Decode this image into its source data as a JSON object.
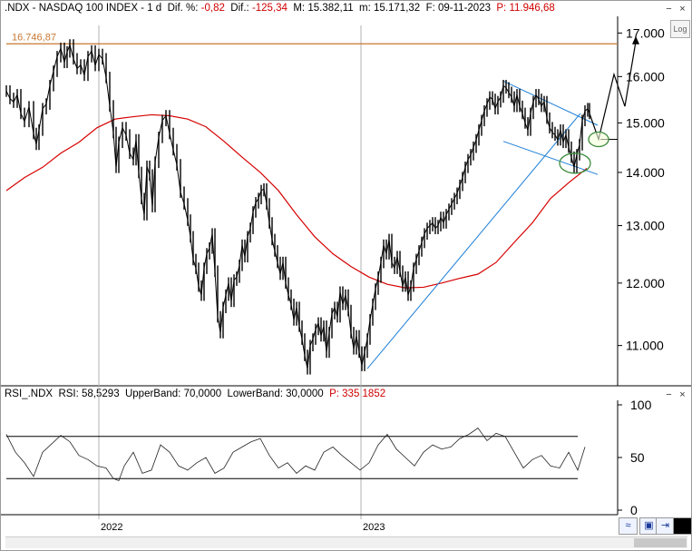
{
  "header": {
    "symbol": ".NDX - NASDAQ 100 INDEX - 1 d",
    "dif_pct_label": "Dif. %:",
    "dif_pct_value": "-0,82",
    "dif_label": "Dif.:",
    "dif_value": "-125,34",
    "max_label": "M:",
    "max_value": "15.382,11",
    "min_label": "m:",
    "min_value": "15.171,32",
    "date_label": "F:",
    "date_value": "09-11-2023",
    "p_label": "P:",
    "p_value": "11.946,68"
  },
  "sub_header": {
    "name": "RSI_.NDX",
    "rsi_label": "RSI:",
    "rsi_value": "58,5293",
    "upper_label": "UpperBand:",
    "upper_value": "70,0000",
    "lower_label": "LowerBand:",
    "lower_value": "30,0000",
    "p_label": "P:",
    "p_value": "335,1852"
  },
  "buttons": {
    "log": "Log",
    "minimize": "−",
    "close": "×"
  },
  "colors": {
    "price": "#000000",
    "ma": "#d60000",
    "trend": "#1e7fd6",
    "resistance": "#c87832",
    "highlight": "#3a8a3a"
  },
  "chart_data": [
    {
      "type": "line",
      "title": "",
      "scale": "log",
      "y_ticks": [
        "17.000",
        "16.000",
        "15.000",
        "14.000",
        "13.000",
        "12.000",
        "11.000"
      ],
      "ylim": [
        10400,
        17400
      ],
      "x_ticks": [
        "2022",
        "2023"
      ],
      "resistance_label": "16.746,87",
      "resistance_value": 16746.87,
      "price_series": [
        [
          0,
          15680
        ],
        [
          4,
          15520
        ],
        [
          8,
          15440
        ],
        [
          12,
          15600
        ],
        [
          16,
          15200
        ],
        [
          20,
          15030
        ],
        [
          25,
          15340
        ],
        [
          30,
          14780
        ],
        [
          33,
          14560
        ],
        [
          36,
          14850
        ],
        [
          40,
          15300
        ],
        [
          44,
          15400
        ],
        [
          48,
          15800
        ],
        [
          52,
          16120
        ],
        [
          56,
          16450
        ],
        [
          60,
          16640
        ],
        [
          64,
          16320
        ],
        [
          67,
          16560
        ],
        [
          70,
          16720
        ],
        [
          74,
          16400
        ],
        [
          78,
          16180
        ],
        [
          82,
          16260
        ],
        [
          86,
          16030
        ],
        [
          90,
          16450
        ],
        [
          94,
          16580
        ],
        [
          98,
          16250
        ],
        [
          102,
          16500
        ],
        [
          106,
          16400
        ],
        [
          110,
          15980
        ],
        [
          114,
          15360
        ],
        [
          118,
          14800
        ],
        [
          121,
          14100
        ],
        [
          124,
          14600
        ],
        [
          128,
          14900
        ],
        [
          132,
          14750
        ],
        [
          136,
          14380
        ],
        [
          140,
          14250
        ],
        [
          143,
          14650
        ],
        [
          146,
          14000
        ],
        [
          149,
          13500
        ],
        [
          152,
          13200
        ],
        [
          155,
          14120
        ],
        [
          158,
          13950
        ],
        [
          161,
          13350
        ],
        [
          164,
          14200
        ],
        [
          168,
          14700
        ],
        [
          172,
          15050
        ],
        [
          176,
          15150
        ],
        [
          180,
          14780
        ],
        [
          184,
          14450
        ],
        [
          188,
          14150
        ],
        [
          192,
          13620
        ],
        [
          196,
          13400
        ],
        [
          200,
          13100
        ],
        [
          203,
          12800
        ],
        [
          206,
          12400
        ],
        [
          209,
          12250
        ],
        [
          212,
          11950
        ],
        [
          215,
          11800
        ],
        [
          218,
          12250
        ],
        [
          221,
          12500
        ],
        [
          224,
          12600
        ],
        [
          227,
          12850
        ],
        [
          230,
          12200
        ],
        [
          233,
          11450
        ],
        [
          236,
          11200
        ],
        [
          239,
          11600
        ],
        [
          242,
          11800
        ],
        [
          245,
          12000
        ],
        [
          248,
          11700
        ],
        [
          251,
          12050
        ],
        [
          254,
          12100
        ],
        [
          257,
          12300
        ],
        [
          260,
          12650
        ],
        [
          263,
          12450
        ],
        [
          266,
          12800
        ],
        [
          269,
          12950
        ],
        [
          272,
          13250
        ],
        [
          275,
          13420
        ],
        [
          278,
          13500
        ],
        [
          281,
          13650
        ],
        [
          284,
          13680
        ],
        [
          287,
          13400
        ],
        [
          290,
          13050
        ],
        [
          293,
          12750
        ],
        [
          296,
          12550
        ],
        [
          299,
          12350
        ],
        [
          302,
          12150
        ],
        [
          305,
          12350
        ],
        [
          308,
          12000
        ],
        [
          311,
          11800
        ],
        [
          314,
          11650
        ],
        [
          317,
          11400
        ],
        [
          320,
          11600
        ],
        [
          323,
          11300
        ],
        [
          326,
          11100
        ],
        [
          329,
          10850
        ],
        [
          332,
          10650
        ],
        [
          335,
          11000
        ],
        [
          338,
          11100
        ],
        [
          341,
          11250
        ],
        [
          344,
          11350
        ],
        [
          347,
          11150
        ],
        [
          350,
          11300
        ],
        [
          353,
          10900
        ],
        [
          356,
          11200
        ],
        [
          359,
          11500
        ],
        [
          362,
          11600
        ],
        [
          365,
          11450
        ],
        [
          368,
          11850
        ],
        [
          371,
          11650
        ],
        [
          374,
          11800
        ],
        [
          377,
          11550
        ],
        [
          380,
          11200
        ],
        [
          383,
          10950
        ],
        [
          386,
          11150
        ],
        [
          389,
          10900
        ],
        [
          392,
          10700
        ],
        [
          395,
          10900
        ],
        [
          398,
          11100
        ],
        [
          401,
          11400
        ],
        [
          404,
          11650
        ],
        [
          407,
          11900
        ],
        [
          410,
          12100
        ],
        [
          413,
          12350
        ],
        [
          416,
          12650
        ],
        [
          419,
          12500
        ],
        [
          422,
          12750
        ],
        [
          425,
          12350
        ],
        [
          428,
          12250
        ],
        [
          431,
          12450
        ],
        [
          434,
          12200
        ],
        [
          437,
          11950
        ],
        [
          440,
          12100
        ],
        [
          443,
          11800
        ],
        [
          446,
          11950
        ],
        [
          449,
          12250
        ],
        [
          452,
          12400
        ],
        [
          455,
          12550
        ],
        [
          458,
          12700
        ],
        [
          461,
          12850
        ],
        [
          464,
          12950
        ],
        [
          467,
          13000
        ],
        [
          470,
          13050
        ],
        [
          473,
          12950
        ],
        [
          476,
          13000
        ],
        [
          479,
          13150
        ],
        [
          482,
          13050
        ],
        [
          485,
          13200
        ],
        [
          488,
          13300
        ],
        [
          491,
          13400
        ],
        [
          494,
          13500
        ],
        [
          497,
          13600
        ],
        [
          500,
          13750
        ],
        [
          503,
          13900
        ],
        [
          506,
          14100
        ],
        [
          509,
          14250
        ],
        [
          512,
          14350
        ],
        [
          515,
          14500
        ],
        [
          518,
          14650
        ],
        [
          521,
          14850
        ],
        [
          524,
          15050
        ],
        [
          527,
          15250
        ],
        [
          530,
          15400
        ],
        [
          533,
          15550
        ],
        [
          536,
          15500
        ],
        [
          539,
          15300
        ],
        [
          542,
          15450
        ],
        [
          545,
          15550
        ],
        [
          548,
          15800
        ],
        [
          551,
          15750
        ],
        [
          554,
          15650
        ],
        [
          557,
          15550
        ],
        [
          560,
          15350
        ],
        [
          563,
          15600
        ],
        [
          566,
          15350
        ],
        [
          569,
          15200
        ],
        [
          572,
          15000
        ],
        [
          575,
          14850
        ],
        [
          578,
          15200
        ],
        [
          581,
          15450
        ],
        [
          584,
          15600
        ],
        [
          587,
          15500
        ],
        [
          590,
          15350
        ],
        [
          593,
          15450
        ],
        [
          596,
          15100
        ],
        [
          599,
          14900
        ],
        [
          602,
          14800
        ],
        [
          605,
          14750
        ],
        [
          608,
          14650
        ],
        [
          611,
          14850
        ],
        [
          614,
          14600
        ],
        [
          617,
          14750
        ],
        [
          620,
          14500
        ],
        [
          623,
          14300
        ],
        [
          626,
          14100
        ],
        [
          629,
          14350
        ],
        [
          632,
          14550
        ],
        [
          635,
          15050
        ],
        [
          638,
          15250
        ],
        [
          641,
          15300
        ],
        [
          643,
          15200
        ]
      ],
      "moving_average": [
        [
          0,
          13650
        ],
        [
          20,
          13900
        ],
        [
          40,
          14100
        ],
        [
          60,
          14380
        ],
        [
          80,
          14600
        ],
        [
          100,
          14900
        ],
        [
          120,
          15080
        ],
        [
          140,
          15130
        ],
        [
          160,
          15170
        ],
        [
          180,
          15150
        ],
        [
          200,
          15080
        ],
        [
          220,
          14920
        ],
        [
          240,
          14620
        ],
        [
          260,
          14300
        ],
        [
          280,
          14000
        ],
        [
          300,
          13650
        ],
        [
          320,
          13200
        ],
        [
          340,
          12800
        ],
        [
          360,
          12500
        ],
        [
          380,
          12280
        ],
        [
          400,
          12100
        ],
        [
          420,
          11980
        ],
        [
          440,
          11920
        ],
        [
          460,
          11930
        ],
        [
          480,
          12000
        ],
        [
          500,
          12080
        ],
        [
          520,
          12150
        ],
        [
          540,
          12350
        ],
        [
          560,
          12700
        ],
        [
          580,
          13050
        ],
        [
          600,
          13500
        ],
        [
          620,
          13800
        ],
        [
          640,
          14080
        ]
      ],
      "projection": [
        [
          643,
          15200
        ],
        [
          653,
          14660
        ],
        [
          670,
          16050
        ],
        [
          682,
          15350
        ],
        [
          694,
          16800
        ]
      ],
      "trend_lines": [
        {
          "from": [
            398,
            10650
          ],
          "to": [
            633,
            15200
          ]
        },
        {
          "from": [
            548,
            15900
          ],
          "to": [
            652,
            14950
          ]
        },
        {
          "from": [
            548,
            14620
          ],
          "to": [
            652,
            13960
          ]
        }
      ],
      "highlights": [
        {
          "center": [
            627,
            14180
          ],
          "label": ""
        },
        {
          "center": [
            653,
            14660
          ],
          "label": ""
        }
      ]
    },
    {
      "type": "line",
      "title": "",
      "y_ticks": [
        "100",
        "50",
        "0"
      ],
      "ylim": [
        0,
        100
      ],
      "upper_band": 70,
      "lower_band": 30,
      "rsi_series": [
        [
          0,
          72
        ],
        [
          10,
          55
        ],
        [
          20,
          45
        ],
        [
          30,
          32
        ],
        [
          40,
          55
        ],
        [
          50,
          63
        ],
        [
          60,
          71
        ],
        [
          70,
          65
        ],
        [
          80,
          52
        ],
        [
          90,
          48
        ],
        [
          100,
          42
        ],
        [
          110,
          40
        ],
        [
          118,
          30
        ],
        [
          124,
          28
        ],
        [
          130,
          42
        ],
        [
          140,
          55
        ],
        [
          150,
          35
        ],
        [
          160,
          38
        ],
        [
          170,
          62
        ],
        [
          180,
          55
        ],
        [
          190,
          42
        ],
        [
          200,
          38
        ],
        [
          210,
          45
        ],
        [
          220,
          50
        ],
        [
          230,
          35
        ],
        [
          240,
          40
        ],
        [
          250,
          55
        ],
        [
          260,
          60
        ],
        [
          270,
          65
        ],
        [
          280,
          68
        ],
        [
          290,
          52
        ],
        [
          300,
          40
        ],
        [
          310,
          45
        ],
        [
          320,
          35
        ],
        [
          330,
          42
        ],
        [
          340,
          38
        ],
        [
          350,
          55
        ],
        [
          360,
          60
        ],
        [
          370,
          52
        ],
        [
          380,
          45
        ],
        [
          390,
          38
        ],
        [
          400,
          45
        ],
        [
          410,
          62
        ],
        [
          420,
          72
        ],
        [
          430,
          58
        ],
        [
          440,
          50
        ],
        [
          450,
          42
        ],
        [
          460,
          55
        ],
        [
          470,
          62
        ],
        [
          480,
          58
        ],
        [
          490,
          60
        ],
        [
          500,
          68
        ],
        [
          510,
          72
        ],
        [
          520,
          78
        ],
        [
          530,
          66
        ],
        [
          540,
          73
        ],
        [
          550,
          70
        ],
        [
          560,
          55
        ],
        [
          570,
          40
        ],
        [
          580,
          48
        ],
        [
          590,
          52
        ],
        [
          600,
          42
        ],
        [
          610,
          40
        ],
        [
          620,
          55
        ],
        [
          630,
          38
        ],
        [
          638,
          60
        ]
      ]
    }
  ]
}
